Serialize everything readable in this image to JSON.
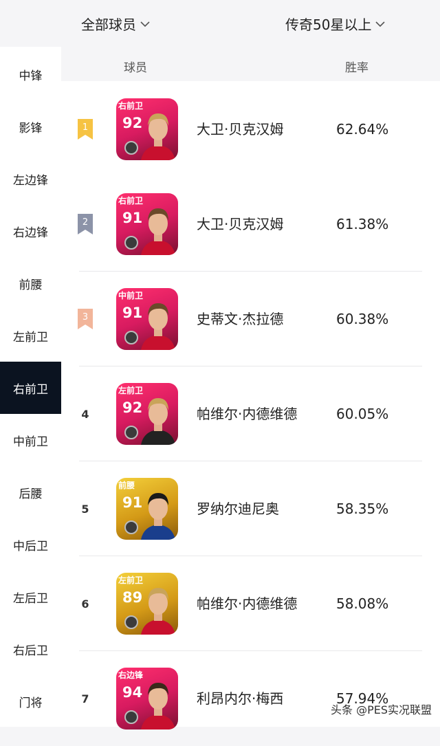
{
  "filters": {
    "left_label": "全部球员",
    "right_label": "传奇50星以上"
  },
  "sidebar": {
    "items": [
      {
        "label": "中锋"
      },
      {
        "label": "影锋"
      },
      {
        "label": "左边锋"
      },
      {
        "label": "右边锋"
      },
      {
        "label": "前腰"
      },
      {
        "label": "左前卫"
      },
      {
        "label": "右前卫",
        "active": true
      },
      {
        "label": "中前卫"
      },
      {
        "label": "后腰"
      },
      {
        "label": "中后卫"
      },
      {
        "label": "左后卫"
      },
      {
        "label": "右后卫"
      },
      {
        "label": "门将"
      }
    ]
  },
  "table": {
    "header_player": "球员",
    "header_winrate": "胜率",
    "rows": [
      {
        "rank": "1",
        "medal": "gold",
        "position": "右前卫",
        "rating": "92",
        "card_color": "#d81b60",
        "name": "大卫·贝克汉姆",
        "winrate": "62.64%"
      },
      {
        "rank": "2",
        "medal": "silver",
        "position": "右前卫",
        "rating": "91",
        "card_color": "#d81b60",
        "name": "大卫·贝克汉姆",
        "winrate": "61.38%"
      },
      {
        "rank": "3",
        "medal": "bronze",
        "position": "中前卫",
        "rating": "91",
        "card_color": "#d81b60",
        "name": "史蒂文·杰拉德",
        "winrate": "60.38%"
      },
      {
        "rank": "4",
        "medal": "",
        "position": "左前卫",
        "rating": "92",
        "card_color": "#d81b60",
        "name": "帕维尔·内德维德",
        "winrate": "60.05%"
      },
      {
        "rank": "5",
        "medal": "",
        "position": "前腰",
        "rating": "91",
        "card_color": "#d4a017",
        "name": "罗纳尔迪尼奥",
        "winrate": "58.35%"
      },
      {
        "rank": "6",
        "medal": "",
        "position": "左前卫",
        "rating": "89",
        "card_color": "#d4a017",
        "name": "帕维尔·内德维德",
        "winrate": "58.08%"
      },
      {
        "rank": "7",
        "medal": "",
        "position": "右边锋",
        "rating": "94",
        "card_color": "#d81b60",
        "name": "利昂内尔·梅西",
        "winrate": "57.94%"
      }
    ]
  },
  "watermark": "头条 @PES实况联盟",
  "colors": {
    "active_sidebar": "#0b1320",
    "gold_medal": "#f6c343",
    "silver_medal": "#8c93a8",
    "bronze_medal": "#f2b59a"
  },
  "icons": [
    "chevron-down-icon",
    "medal-icon",
    "player-portrait",
    "team-badge-icon"
  ]
}
